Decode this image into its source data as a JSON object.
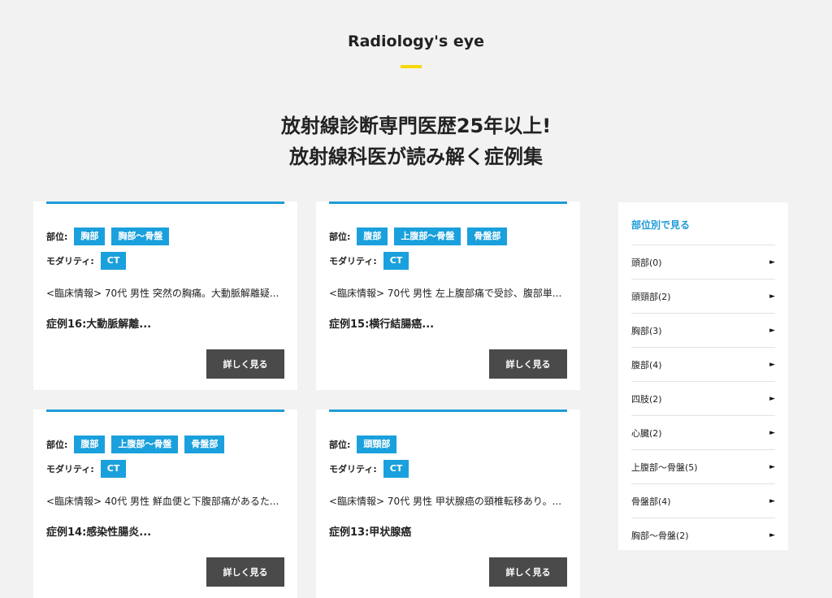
{
  "header": {
    "section_title": "Radiology's eye",
    "headline_line1": "放射線診断専門医歴25年以上!",
    "headline_line2": "放射線科医が読み解く症例集"
  },
  "labels": {
    "region": "部位:",
    "modality": "モダリティ:",
    "more_button": "詳しく見る"
  },
  "cards": [
    {
      "regions": [
        "胸部",
        "胸部〜骨盤"
      ],
      "modality": "CT",
      "excerpt": "<臨床情報> 70代 男性 突然の胸痛。大動脈解離疑...",
      "title": "症例16:大動脈解離..."
    },
    {
      "regions": [
        "腹部",
        "上腹部〜骨盤",
        "骨盤部"
      ],
      "modality": "CT",
      "excerpt": "<臨床情報> 70代 男性 左上腹部痛で受診、腹部単...",
      "title": "症例15:横行結腸癌..."
    },
    {
      "regions": [
        "腹部",
        "上腹部〜骨盤",
        "骨盤部"
      ],
      "modality": "CT",
      "excerpt": "<臨床情報> 40代 男性 鮮血便と下腹部痛があるた...",
      "title": "症例14:感染性腸炎..."
    },
    {
      "regions": [
        "頭頸部"
      ],
      "modality": "CT",
      "excerpt": "<臨床情報> 70代 男性 甲状腺癌の頸椎転移あり。...",
      "title": "症例13:甲状腺癌"
    }
  ],
  "sidebar": {
    "title": "部位別で見る",
    "items": [
      {
        "label": "頭部(0)"
      },
      {
        "label": "頭頸部(2)"
      },
      {
        "label": "胸部(3)"
      },
      {
        "label": "腹部(4)"
      },
      {
        "label": "四肢(2)"
      },
      {
        "label": "心臓(2)"
      },
      {
        "label": "上腹部〜骨盤(5)"
      },
      {
        "label": "骨盤部(4)"
      },
      {
        "label": "胸部〜骨盤(2)"
      }
    ]
  },
  "colors": {
    "accent_blue": "#1aa0dc",
    "accent_yellow": "#f5d90a",
    "button_dark": "#4a4a4a",
    "background": "#f2f2f2"
  }
}
